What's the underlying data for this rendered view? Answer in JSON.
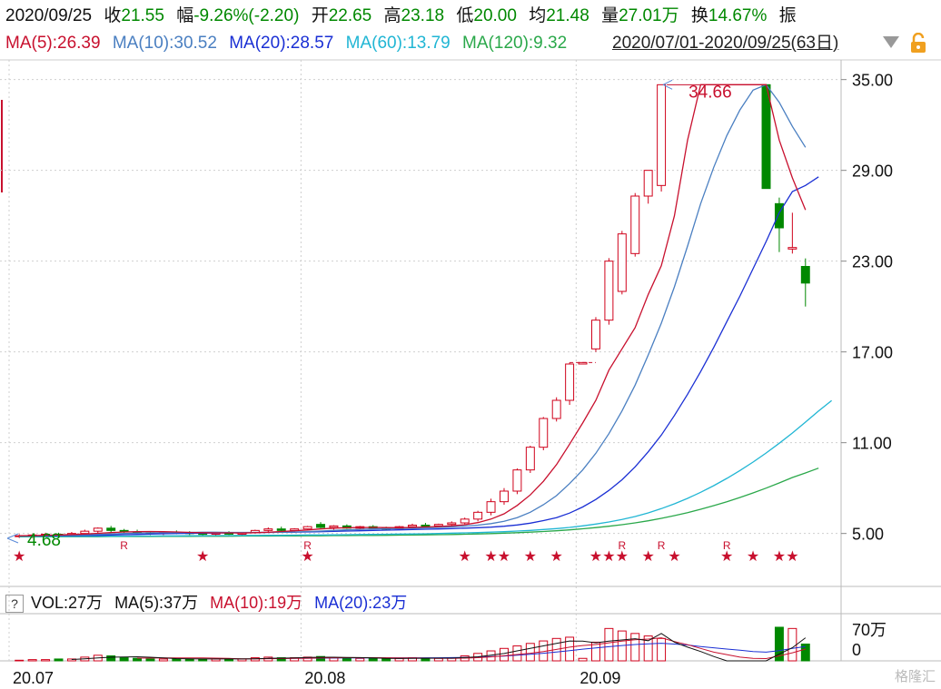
{
  "header": {
    "date": "2020/09/25",
    "close_label": "收",
    "close_value": "21.55",
    "change_label": "幅",
    "change_value": "-9.26%(-2.20)",
    "open_label": "开",
    "open_value": "22.65",
    "high_label": "高",
    "high_value": "23.18",
    "low_label": "低",
    "low_value": "20.00",
    "avg_label": "均",
    "avg_value": "21.48",
    "volume_label": "量",
    "volume_value": "27.01万",
    "turnover_label": "换",
    "turnover_value": "14.67%",
    "amplitude_label": "振"
  },
  "ma_legend": {
    "ma5": "MA(5):26.39",
    "ma10": "MA(10):30.52",
    "ma20": "MA(20):28.57",
    "ma60": "MA(60):13.79",
    "ma120": "MA(120):9.32"
  },
  "range_selector": {
    "label": "2020/07/01-2020/09/25(63日)"
  },
  "volume_legend": {
    "vol": "VOL:27万",
    "ma5": "MA(5):37万",
    "ma10": "MA(10):19万",
    "ma20": "MA(20):23万"
  },
  "colors": {
    "up": "#d0021b",
    "down": "#008800",
    "ma5": "#c8102e",
    "ma10": "#4a7fc1",
    "ma20": "#1a2fd4",
    "ma60": "#21b6d4",
    "ma120": "#2aa84a"
  },
  "annotations": {
    "high_marker": "34.66",
    "low_marker": "4.68"
  },
  "watermark": "格隆汇",
  "chart_data": {
    "type": "candlestick",
    "y_ticks": [
      "35.00",
      "29.00",
      "23.00",
      "17.00",
      "11.00",
      "5.00"
    ],
    "y_range": [
      1.5,
      36.3
    ],
    "x_ticks": [
      "20.07",
      "20.08",
      "20.09"
    ],
    "volume_ticks": [
      "70万",
      "0"
    ],
    "volume_range": [
      0,
      70
    ],
    "candles": [
      {
        "o": 4.8,
        "h": 4.95,
        "l": 4.7,
        "c": 4.85,
        "v": 1
      },
      {
        "o": 4.8,
        "h": 4.95,
        "l": 4.7,
        "c": 4.9,
        "v": 2
      },
      {
        "o": 4.9,
        "h": 5.05,
        "l": 4.8,
        "c": 4.95,
        "v": 2
      },
      {
        "o": 4.95,
        "h": 5.05,
        "l": 4.8,
        "c": 4.9,
        "v": 3
      },
      {
        "o": 4.9,
        "h": 5.1,
        "l": 4.8,
        "c": 5.0,
        "v": 3
      },
      {
        "o": 5.0,
        "h": 5.25,
        "l": 4.9,
        "c": 5.15,
        "v": 6
      },
      {
        "o": 5.15,
        "h": 5.4,
        "l": 5.0,
        "c": 5.35,
        "v": 9
      },
      {
        "o": 5.35,
        "h": 5.5,
        "l": 5.1,
        "c": 5.2,
        "v": 8
      },
      {
        "o": 5.2,
        "h": 5.3,
        "l": 5.0,
        "c": 5.1,
        "v": 5
      },
      {
        "o": 5.1,
        "h": 5.25,
        "l": 4.95,
        "c": 5.05,
        "v": 4
      },
      {
        "o": 5.05,
        "h": 5.15,
        "l": 4.9,
        "c": 5.0,
        "v": 3
      },
      {
        "o": 5.0,
        "h": 5.15,
        "l": 4.9,
        "c": 5.1,
        "v": 3
      },
      {
        "o": 5.1,
        "h": 5.2,
        "l": 4.95,
        "c": 5.05,
        "v": 3
      },
      {
        "o": 5.05,
        "h": 5.15,
        "l": 4.9,
        "c": 5.0,
        "v": 3
      },
      {
        "o": 5.0,
        "h": 5.1,
        "l": 4.85,
        "c": 4.95,
        "v": 3
      },
      {
        "o": 4.95,
        "h": 5.1,
        "l": 4.85,
        "c": 5.05,
        "v": 3
      },
      {
        "o": 5.05,
        "h": 5.15,
        "l": 4.9,
        "c": 4.95,
        "v": 3
      },
      {
        "o": 4.95,
        "h": 5.1,
        "l": 4.85,
        "c": 5.05,
        "v": 3
      },
      {
        "o": 5.05,
        "h": 5.25,
        "l": 5.0,
        "c": 5.2,
        "v": 5
      },
      {
        "o": 5.2,
        "h": 5.4,
        "l": 5.05,
        "c": 5.3,
        "v": 6
      },
      {
        "o": 5.3,
        "h": 5.45,
        "l": 5.1,
        "c": 5.2,
        "v": 5
      },
      {
        "o": 5.2,
        "h": 5.35,
        "l": 5.05,
        "c": 5.3,
        "v": 5
      },
      {
        "o": 5.3,
        "h": 5.5,
        "l": 5.2,
        "c": 5.45,
        "v": 6
      },
      {
        "o": 5.6,
        "h": 5.75,
        "l": 5.35,
        "c": 5.4,
        "v": 7
      },
      {
        "o": 5.4,
        "h": 5.55,
        "l": 5.25,
        "c": 5.5,
        "v": 5
      },
      {
        "o": 5.5,
        "h": 5.6,
        "l": 5.3,
        "c": 5.35,
        "v": 4
      },
      {
        "o": 5.35,
        "h": 5.5,
        "l": 5.25,
        "c": 5.45,
        "v": 4
      },
      {
        "o": 5.45,
        "h": 5.55,
        "l": 5.3,
        "c": 5.35,
        "v": 4
      },
      {
        "o": 5.35,
        "h": 5.45,
        "l": 5.2,
        "c": 5.3,
        "v": 3
      },
      {
        "o": 5.3,
        "h": 5.5,
        "l": 5.25,
        "c": 5.45,
        "v": 4
      },
      {
        "o": 5.45,
        "h": 5.65,
        "l": 5.35,
        "c": 5.55,
        "v": 5
      },
      {
        "o": 5.55,
        "h": 5.7,
        "l": 5.4,
        "c": 5.5,
        "v": 4
      },
      {
        "o": 5.5,
        "h": 5.65,
        "l": 5.4,
        "c": 5.6,
        "v": 4
      },
      {
        "o": 5.6,
        "h": 5.8,
        "l": 5.5,
        "c": 5.7,
        "v": 5
      },
      {
        "o": 5.7,
        "h": 6.05,
        "l": 5.55,
        "c": 5.95,
        "v": 8
      },
      {
        "o": 5.95,
        "h": 6.5,
        "l": 5.8,
        "c": 6.4,
        "v": 12
      },
      {
        "o": 6.4,
        "h": 7.3,
        "l": 6.2,
        "c": 7.1,
        "v": 16
      },
      {
        "o": 7.1,
        "h": 8.0,
        "l": 6.9,
        "c": 7.8,
        "v": 20
      },
      {
        "o": 7.8,
        "h": 9.3,
        "l": 7.6,
        "c": 9.2,
        "v": 24
      },
      {
        "o": 9.2,
        "h": 10.8,
        "l": 9.0,
        "c": 10.7,
        "v": 28
      },
      {
        "o": 10.7,
        "h": 12.7,
        "l": 10.5,
        "c": 12.6,
        "v": 32
      },
      {
        "o": 12.6,
        "h": 14.0,
        "l": 12.4,
        "c": 13.8,
        "v": 36
      },
      {
        "o": 13.8,
        "h": 16.3,
        "l": 13.5,
        "c": 16.2,
        "v": 38
      },
      {
        "o": 16.2,
        "h": 16.3,
        "l": 16.2,
        "c": 16.3,
        "v": 4
      },
      {
        "o": 17.2,
        "h": 19.3,
        "l": 17.0,
        "c": 19.1,
        "v": 30
      },
      {
        "o": 19.1,
        "h": 23.2,
        "l": 18.8,
        "c": 23.0,
        "v": 52
      },
      {
        "o": 21.0,
        "h": 25.0,
        "l": 20.8,
        "c": 24.8,
        "v": 48
      },
      {
        "o": 23.5,
        "h": 27.5,
        "l": 23.3,
        "c": 27.3,
        "v": 44
      },
      {
        "o": 27.3,
        "h": 29.0,
        "l": 26.8,
        "c": 29.0,
        "v": 40
      },
      {
        "o": 28.0,
        "h": 34.66,
        "l": 27.6,
        "c": 34.66,
        "v": 36
      },
      {
        "o": null,
        "h": null,
        "l": null,
        "c": null,
        "v": 0
      },
      {
        "o": null,
        "h": null,
        "l": null,
        "c": null,
        "v": 0
      },
      {
        "o": null,
        "h": null,
        "l": null,
        "c": null,
        "v": 0
      },
      {
        "o": null,
        "h": null,
        "l": null,
        "c": null,
        "v": 0
      },
      {
        "o": null,
        "h": null,
        "l": null,
        "c": null,
        "v": 0
      },
      {
        "o": null,
        "h": null,
        "l": null,
        "c": null,
        "v": 0
      },
      {
        "o": null,
        "h": null,
        "l": null,
        "c": null,
        "v": 0
      },
      {
        "o": 34.66,
        "h": 34.66,
        "l": 27.8,
        "c": 27.8,
        "v": 0
      },
      {
        "o": 26.8,
        "h": 27.2,
        "l": 23.6,
        "c": 25.2,
        "v": 54
      },
      {
        "o": 23.8,
        "h": 26.2,
        "l": 23.5,
        "c": 23.9,
        "v": 52
      },
      {
        "o": 22.65,
        "h": 23.18,
        "l": 20.0,
        "c": 21.55,
        "v": 27
      }
    ],
    "ma5": [
      4.85,
      4.86,
      4.88,
      4.9,
      4.93,
      4.96,
      5.01,
      5.06,
      5.1,
      5.12,
      5.13,
      5.12,
      5.1,
      5.07,
      5.05,
      5.04,
      5.04,
      5.03,
      5.05,
      5.08,
      5.13,
      5.18,
      5.23,
      5.3,
      5.35,
      5.38,
      5.39,
      5.4,
      5.39,
      5.38,
      5.4,
      5.43,
      5.46,
      5.51,
      5.58,
      5.72,
      5.95,
      6.3,
      6.85,
      7.55,
      8.45,
      9.55,
      10.9,
      12.3,
      13.8,
      15.8,
      17.2,
      18.6,
      20.8,
      22.7,
      26.0,
      31.0,
      34.66,
      34.66,
      34.66,
      34.66,
      34.66,
      34.66,
      31.0,
      28.5,
      26.39
    ],
    "ma10": [
      4.84,
      4.85,
      4.86,
      4.87,
      4.89,
      4.91,
      4.94,
      4.97,
      5.0,
      5.02,
      5.04,
      5.05,
      5.06,
      5.07,
      5.08,
      5.08,
      5.07,
      5.07,
      5.07,
      5.07,
      5.08,
      5.1,
      5.13,
      5.16,
      5.2,
      5.24,
      5.27,
      5.3,
      5.32,
      5.33,
      5.35,
      5.37,
      5.4,
      5.44,
      5.49,
      5.55,
      5.65,
      5.8,
      6.05,
      6.4,
      6.9,
      7.5,
      8.3,
      9.2,
      10.3,
      11.6,
      13.1,
      14.8,
      16.8,
      18.9,
      21.3,
      24.0,
      26.8,
      29.2,
      31.3,
      33.0,
      34.3,
      34.66,
      33.5,
      31.9,
      30.52
    ],
    "ma20": [
      4.83,
      4.84,
      4.84,
      4.85,
      4.86,
      4.87,
      4.88,
      4.9,
      4.92,
      4.94,
      4.96,
      4.98,
      5.0,
      5.01,
      5.02,
      5.03,
      5.04,
      5.05,
      5.06,
      5.07,
      5.08,
      5.09,
      5.1,
      5.12,
      5.14,
      5.16,
      5.18,
      5.2,
      5.22,
      5.24,
      5.26,
      5.28,
      5.3,
      5.32,
      5.35,
      5.38,
      5.42,
      5.48,
      5.56,
      5.68,
      5.85,
      6.05,
      6.35,
      6.75,
      7.25,
      7.85,
      8.55,
      9.4,
      10.4,
      11.5,
      12.8,
      14.2,
      15.7,
      17.3,
      19.0,
      20.7,
      22.5,
      24.3,
      26.2,
      27.6,
      28.0,
      28.57
    ],
    "ma60": [
      4.8,
      4.8,
      4.8,
      4.81,
      4.81,
      4.81,
      4.82,
      4.82,
      4.82,
      4.83,
      4.83,
      4.84,
      4.84,
      4.85,
      4.85,
      4.86,
      4.86,
      4.87,
      4.87,
      4.88,
      4.88,
      4.89,
      4.9,
      4.9,
      4.91,
      4.92,
      4.93,
      4.94,
      4.95,
      4.96,
      4.97,
      4.98,
      5.0,
      5.02,
      5.04,
      5.06,
      5.09,
      5.12,
      5.16,
      5.2,
      5.26,
      5.32,
      5.4,
      5.5,
      5.62,
      5.76,
      5.92,
      6.12,
      6.36,
      6.64,
      6.96,
      7.32,
      7.72,
      8.16,
      8.64,
      9.16,
      9.72,
      10.32,
      10.96,
      11.64,
      12.36,
      13.1,
      13.79
    ],
    "ma120": [
      4.78,
      4.78,
      4.78,
      4.79,
      4.79,
      4.79,
      4.79,
      4.8,
      4.8,
      4.8,
      4.8,
      4.81,
      4.81,
      4.81,
      4.82,
      4.82,
      4.82,
      4.83,
      4.83,
      4.83,
      4.84,
      4.84,
      4.85,
      4.85,
      4.86,
      4.86,
      4.87,
      4.87,
      4.88,
      4.89,
      4.9,
      4.91,
      4.92,
      4.93,
      4.95,
      4.97,
      4.99,
      5.02,
      5.05,
      5.09,
      5.13,
      5.18,
      5.24,
      5.31,
      5.39,
      5.48,
      5.58,
      5.7,
      5.84,
      6.0,
      6.18,
      6.38,
      6.6,
      6.84,
      7.1,
      7.38,
      7.68,
      8.0,
      8.34,
      8.7,
      9.0,
      9.32
    ],
    "volume_ma5": [
      null,
      null,
      null,
      null,
      2.2,
      3.2,
      4.6,
      5.8,
      6.2,
      6.6,
      5.8,
      4.6,
      3.6,
      3.2,
      3.0,
      3.0,
      3.0,
      3.0,
      3.4,
      4.0,
      4.4,
      4.8,
      5.4,
      5.8,
      5.8,
      5.4,
      5.2,
      4.6,
      4.0,
      3.8,
      4.0,
      4.2,
      4.4,
      4.4,
      5.2,
      6.6,
      9.0,
      11.8,
      16.0,
      20.0,
      24.0,
      28.0,
      32.0,
      31.6,
      29.0,
      31.6,
      33.6,
      35.6,
      32.4,
      44.0,
      30.0,
      22.0,
      15.0,
      7.0,
      0,
      0,
      0,
      0,
      10.8,
      21.2,
      37.0
    ],
    "volume_ma10": [
      null,
      null,
      null,
      null,
      null,
      null,
      null,
      null,
      null,
      4.4,
      4.5,
      4.6,
      4.7,
      4.7,
      4.8,
      4.4,
      3.9,
      3.4,
      3.3,
      3.5,
      3.7,
      3.9,
      4.2,
      4.6,
      4.9,
      5.1,
      5.1,
      5.1,
      5.0,
      4.8,
      4.6,
      4.4,
      4.2,
      4.1,
      4.4,
      5.1,
      6.4,
      8.1,
      10.2,
      12.2,
      15.0,
      18.4,
      22.0,
      24.6,
      26.2,
      29.0,
      31.8,
      34.0,
      35.0,
      37.0,
      31.0,
      26.0,
      20.0,
      14.0,
      10.0,
      6.0,
      4.0,
      3.6,
      8.0,
      13.0,
      19.0
    ],
    "volume_ma20": [
      null,
      null,
      null,
      null,
      null,
      null,
      null,
      null,
      null,
      null,
      null,
      null,
      null,
      null,
      null,
      null,
      null,
      null,
      null,
      4.0,
      4.1,
      4.2,
      4.3,
      4.4,
      4.5,
      4.6,
      4.6,
      4.7,
      4.7,
      4.7,
      4.8,
      4.9,
      5.0,
      5.2,
      5.5,
      6.0,
      6.8,
      7.8,
      9.0,
      10.5,
      12.3,
      14.2,
      16.5,
      18.8,
      20.7,
      22.7,
      24.6,
      26.3,
      27.3,
      28.3,
      27.0,
      25.5,
      23.0,
      21.0,
      19.0,
      17.0,
      15.0,
      14.0,
      16.5,
      20.0,
      23.0
    ],
    "markers": {
      "stars": [
        0,
        14,
        22,
        34,
        36,
        37,
        39,
        41,
        44,
        45,
        46,
        48,
        50,
        54,
        56,
        58,
        59
      ],
      "r": [
        8,
        22,
        46,
        49,
        54
      ]
    }
  }
}
